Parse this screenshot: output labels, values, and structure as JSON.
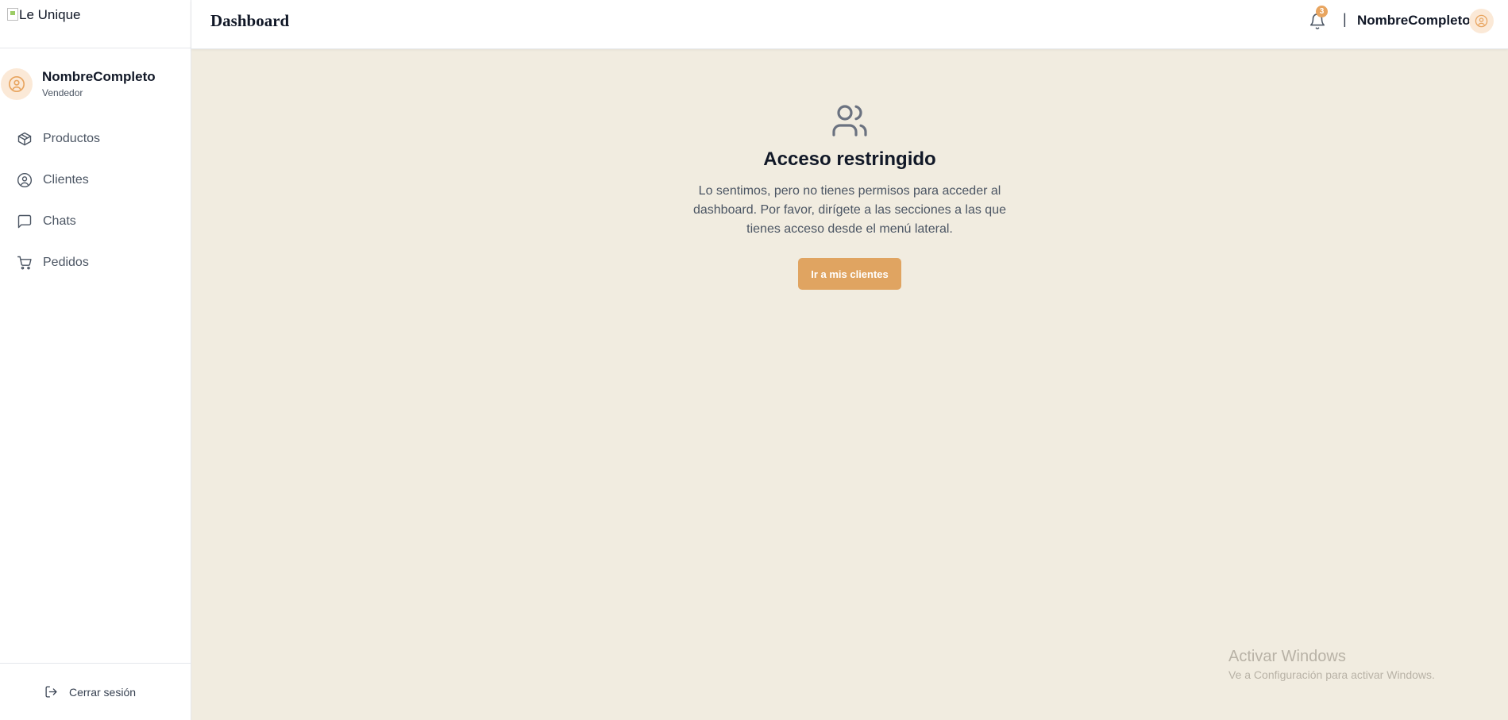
{
  "sidebar": {
    "logo_alt": "Le Unique",
    "user": {
      "name": "NombreCompleto",
      "role": "Vendedor"
    },
    "items": [
      {
        "label": "Productos",
        "icon": "box-icon"
      },
      {
        "label": "Clientes",
        "icon": "user-circle-icon"
      },
      {
        "label": "Chats",
        "icon": "chat-icon"
      },
      {
        "label": "Pedidos",
        "icon": "cart-icon"
      }
    ],
    "logout_label": "Cerrar sesión"
  },
  "header": {
    "title": "Dashboard",
    "notification_count": "3",
    "divider": "|",
    "user_name": "NombreCompleto"
  },
  "main": {
    "title": "Acceso restringido",
    "message": "Lo sentimos, pero no tienes permisos para acceder al dashboard. Por favor, dirígete a las secciones a las que tienes acceso desde el menú lateral.",
    "button_label": "Ir a mis clientes"
  },
  "watermark": {
    "title": "Activar Windows",
    "subtitle": "Ve a Configuración para activar Windows."
  },
  "colors": {
    "accent": "#e0a461",
    "background": "#f1ece0",
    "avatar_bg": "#fbe9d7"
  }
}
